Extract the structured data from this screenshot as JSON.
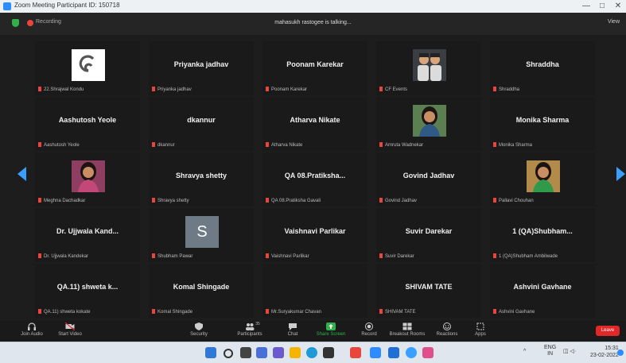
{
  "window": {
    "title": "Zoom Meeting Participant ID: 150718",
    "min": "—",
    "max": "□",
    "close": "✕"
  },
  "topbar": {
    "recording": "Recording",
    "talking": "mahasukh rastogee is talking...",
    "view": "View"
  },
  "tiles": [
    {
      "name": "",
      "label": "22.Shrajwal Kondu",
      "avatar": "logo"
    },
    {
      "name": "Priyanka jadhav",
      "label": "Priyanka jadhav"
    },
    {
      "name": "Poonam Karekar",
      "label": "Poonam Karekar"
    },
    {
      "name": "",
      "label": "CF Events",
      "avatar": "photo-two"
    },
    {
      "name": "Shraddha",
      "label": "Shraddha"
    },
    {
      "name": "Aashutosh Yeole",
      "label": "Aashutosh Yeole"
    },
    {
      "name": "dkannur",
      "label": "dkannur"
    },
    {
      "name": "Atharva Nikate",
      "label": "Atharva Nikate"
    },
    {
      "name": "",
      "label": "Amruta Wadnekar",
      "avatar": "photo-woman"
    },
    {
      "name": "Monika Sharma",
      "label": "Monika Sharma"
    },
    {
      "name": "",
      "label": "Meghna Dachadkar",
      "avatar": "photo-pink"
    },
    {
      "name": "Shravya shetty",
      "label": "Shravya shetty"
    },
    {
      "name": "QA 08.Pratiksha...",
      "label": "QA 08.Pratiksha Gavali"
    },
    {
      "name": "Govind Jadhav",
      "label": "Govind Jadhav"
    },
    {
      "name": "",
      "label": "Pallavi Chouhan",
      "avatar": "photo-green"
    },
    {
      "name": "Dr. Ujjwala Kand...",
      "label": "Dr. Ujjwala Kandekar"
    },
    {
      "name": "",
      "label": "Shubham Pawar",
      "avatar": "letter",
      "letter": "S"
    },
    {
      "name": "Vaishnavi Parlikar",
      "label": "Vaishnavi Parlikar"
    },
    {
      "name": "Suvir Darekar",
      "label": "Suvir Darekar"
    },
    {
      "name": "1 (QA)Shubham...",
      "label": "1 (QA)Shubham Ambilwade"
    },
    {
      "name": "QA.11) shweta k...",
      "label": "QA.11) shweta kokate"
    },
    {
      "name": "Komal Shingade",
      "label": "Komal Shingade"
    },
    {
      "name": "",
      "label": "Mr.Suryakumar Chavan"
    },
    {
      "name": "SHIVAM TATE",
      "label": "SHIVAM TATE"
    },
    {
      "name": "Ashvini Gavhane",
      "label": "Ashvini Gavhane"
    }
  ],
  "controls": [
    {
      "label": "Join Audio",
      "icon": "headphones-icon"
    },
    {
      "label": "Start Video",
      "icon": "video-off-icon"
    },
    {
      "label": "Security",
      "icon": "shield-icon"
    },
    {
      "label": "Participants",
      "icon": "participants-icon",
      "count": "35"
    },
    {
      "label": "Chat",
      "icon": "chat-icon"
    },
    {
      "label": "Share Screen",
      "icon": "share-screen-icon"
    },
    {
      "label": "Record",
      "icon": "record-icon"
    },
    {
      "label": "Breakout Rooms",
      "icon": "breakout-icon"
    },
    {
      "label": "Reactions",
      "icon": "reactions-icon"
    },
    {
      "label": "Apps",
      "icon": "apps-icon"
    }
  ],
  "leave": "Leave",
  "tray": {
    "lang": "ENG",
    "region": "IN",
    "time": "15:31",
    "date": "23-02-2022"
  },
  "colors": {
    "accent": "#2d8cff",
    "leave": "#e02828",
    "share": "#2fb04a"
  }
}
